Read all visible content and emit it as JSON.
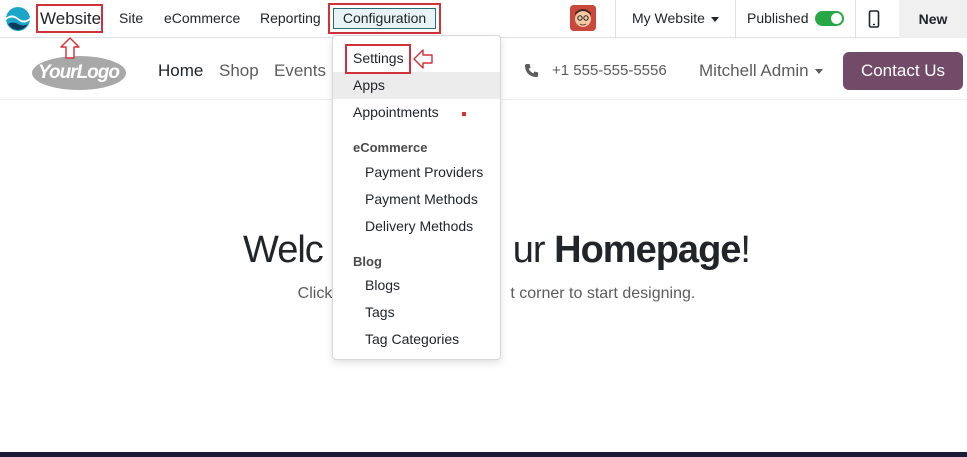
{
  "topbar": {
    "app_name": "Website",
    "menu": [
      "Site",
      "eCommerce",
      "Reporting",
      "Configuration"
    ],
    "website_selector": "My Website",
    "published_label": "Published",
    "published": true,
    "new_label": "New"
  },
  "site_header": {
    "logo_text": "YourLogo",
    "menu": [
      "Home",
      "Shop",
      "Events"
    ],
    "phone": "+1 555-555-5556",
    "user": "Mitchell Admin",
    "contact_button": "Contact Us"
  },
  "hero": {
    "title_start": "Welc",
    "title_mid": "ur ",
    "title_bold": "Homepage",
    "title_end": "!",
    "subtitle_start": "Click",
    "subtitle_end": "t corner to start designing."
  },
  "dropdown": {
    "items": [
      "Settings",
      "Apps",
      "Appointments"
    ],
    "ecommerce_header": "eCommerce",
    "ecommerce_items": [
      "Payment Providers",
      "Payment Methods",
      "Delivery Methods"
    ],
    "blog_header": "Blog",
    "blog_items": [
      "Blogs",
      "Tags",
      "Tag Categories"
    ]
  },
  "colors": {
    "highlight": "#d0313a",
    "brand": "#714b67",
    "toggle_on": "#28a745"
  }
}
